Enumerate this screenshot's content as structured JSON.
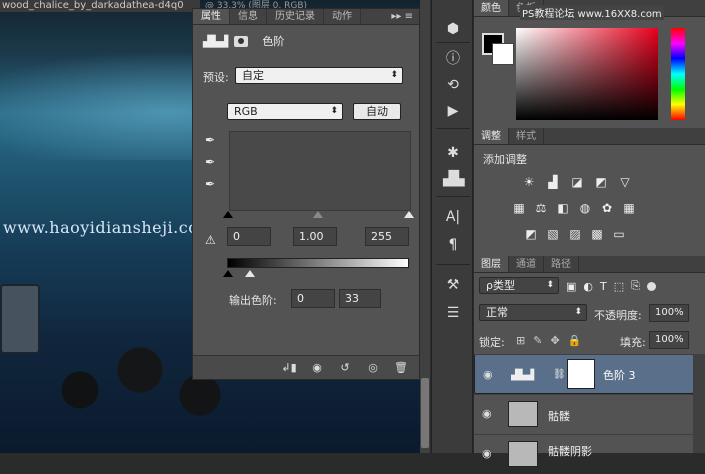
{
  "canvas": {
    "doc_tab": "wood_chalice_by_darkadathea-d4q0",
    "doc_tab_extra": "@ 33.3% (图层 0, RGB)",
    "watermark": "www.haoyidiansheji.com",
    "watermark_top": "PS教程论坛 www.16XX8.com"
  },
  "properties": {
    "tabs": [
      "属性",
      "信息",
      "历史记录",
      "动作"
    ],
    "flyout": "▸▸ ≡",
    "title": "色阶",
    "preset_label": "预设:",
    "preset_value": "自定",
    "channel_value": "RGB",
    "auto_label": "自动",
    "input_black": "0",
    "input_gamma": "1.00",
    "input_white": "255",
    "output_label": "输出色阶:",
    "output_black": "0",
    "output_white": "33"
  },
  "color_panel": {
    "tabs": [
      "颜色",
      "色板"
    ],
    "fg_color": "#000000",
    "bg_color": "#ffffff"
  },
  "adjustments": {
    "tabs": [
      "调整",
      "样式"
    ],
    "title": "添加调整"
  },
  "layers": {
    "tabs": [
      "图层",
      "通道",
      "路径"
    ],
    "filter_value": "ρ类型",
    "blend_value": "正常",
    "opacity_label": "不透明度:",
    "opacity_value": "100%",
    "lock_label": "锁定:",
    "fill_label": "填充:",
    "fill_value": "100%",
    "items": [
      {
        "name": "色阶 3"
      },
      {
        "name": "骷髅"
      },
      {
        "name": "骷髅阴影"
      }
    ]
  }
}
